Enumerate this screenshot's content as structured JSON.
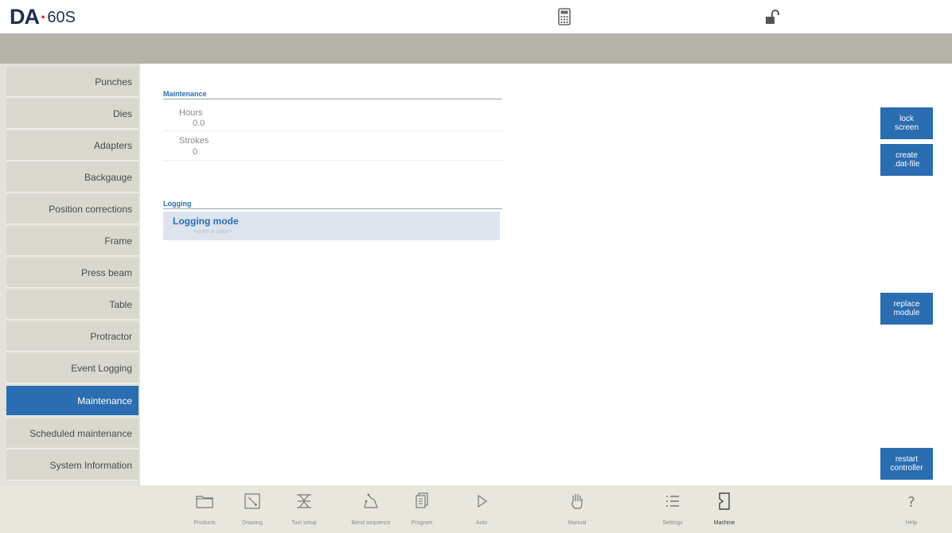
{
  "header": {
    "logo_brand": "DA",
    "logo_dot": "·",
    "logo_model": "60S",
    "calculator_icon": "calculator-icon",
    "lock_icon": "unlock-icon"
  },
  "sidebar": {
    "items": [
      {
        "label": "Punches"
      },
      {
        "label": "Dies"
      },
      {
        "label": "Adapters"
      },
      {
        "label": "Backgauge"
      },
      {
        "label": "Position corrections"
      },
      {
        "label": "Frame"
      },
      {
        "label": "Press beam"
      },
      {
        "label": "Table"
      },
      {
        "label": "Protractor"
      },
      {
        "label": "Event Logging"
      },
      {
        "label": "Maintenance",
        "active": true
      },
      {
        "label": "Scheduled maintenance"
      },
      {
        "label": "System Information"
      }
    ]
  },
  "main": {
    "maintenance": {
      "title": "Maintenance",
      "hours_label": "Hours",
      "hours_value": "0.0",
      "strokes_label": "Strokes",
      "strokes_value": "0"
    },
    "logging": {
      "title": "Logging",
      "mode_label": "Logging mode",
      "mode_placeholder": "<enter a value>"
    }
  },
  "actions": {
    "lock_screen": [
      "lock",
      "screen"
    ],
    "create_dat": [
      "create",
      ".dat-file"
    ],
    "replace_module": [
      "replace",
      "module"
    ],
    "restart_controller": [
      "restart",
      "controller"
    ]
  },
  "bottom_nav": {
    "items": [
      {
        "label": "Products",
        "icon": "folder-icon"
      },
      {
        "label": "Drawing",
        "icon": "pencil-icon"
      },
      {
        "label": "Tool setup",
        "icon": "tool-setup-icon"
      },
      {
        "label": "Bend sequence",
        "icon": "bend-sequence-icon"
      },
      {
        "label": "Program",
        "icon": "program-icon"
      },
      {
        "label": "Auto",
        "icon": "play-icon"
      },
      {
        "label": "Manual",
        "icon": "hand-icon"
      },
      {
        "label": "Settings",
        "icon": "list-icon"
      },
      {
        "label": "Machine",
        "icon": "machine-icon",
        "active": true
      },
      {
        "label": "Help",
        "icon": "help-icon"
      }
    ]
  },
  "colors": {
    "accent": "#2a6db0",
    "sidebar_item": "#d9d8cf",
    "gray_bar": "#b5b3a9",
    "bottom_bar": "#e8e7dd",
    "logo_dark": "#1f2f52",
    "logo_red": "#c8202a"
  }
}
